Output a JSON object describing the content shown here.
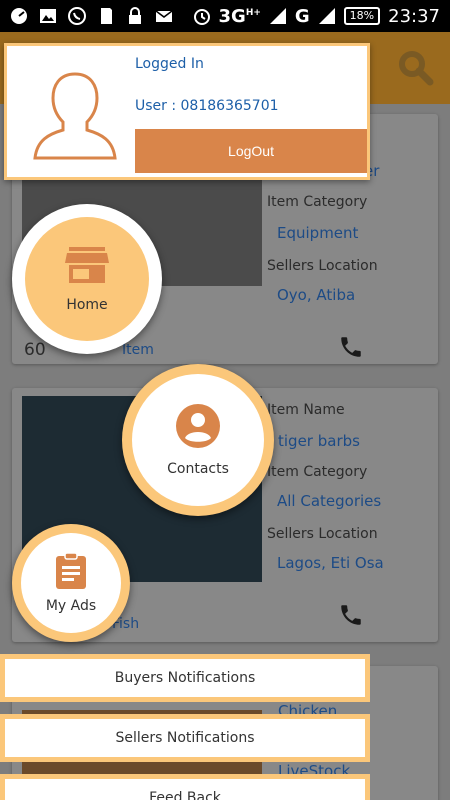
{
  "status_bar": {
    "network": "3G",
    "network_sup": "H+",
    "carrier_letter": "G",
    "battery": "18%",
    "time": "23:37"
  },
  "listings": [
    {
      "category_label": "Item Category",
      "category": "Equipment",
      "location_label": "Sellers Location",
      "location": "Oyo, Atiba",
      "price_prefix": "60",
      "unit": "Item",
      "name_partial": "er"
    },
    {
      "name_label": "Item Name",
      "name": "tiger barbs",
      "category_label": "Item Category",
      "category": "All Categories",
      "location_label": "Sellers Location",
      "location": "Lagos, Eti Osa",
      "unit": "Fish"
    },
    {
      "name": "Chicken",
      "category": "LiveStock"
    }
  ],
  "profile": {
    "status": "Logged In",
    "user": "User : 08186365701",
    "logout_label": "LogOut"
  },
  "menu": {
    "home": "Home",
    "contacts": "Contacts",
    "my_ads": "My Ads",
    "buyers_notifications": "Buyers Notifications",
    "sellers_notifications": "Sellers Notifications",
    "feed_back": "Feed Back"
  },
  "colors": {
    "accent": "#fbc77a",
    "logout": "#d9854a",
    "icon": "#d9854a",
    "link": "#1d5fa8"
  }
}
